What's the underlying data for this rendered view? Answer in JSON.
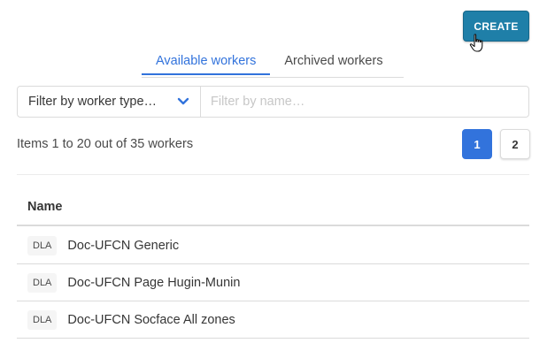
{
  "toolbar": {
    "create_label": "CREATE"
  },
  "tabs": [
    {
      "label": "Available workers",
      "active": true
    },
    {
      "label": "Archived workers",
      "active": false
    }
  ],
  "filters": {
    "type_select_value": "Filter by worker type…",
    "name_placeholder": "Filter by name…",
    "name_value": ""
  },
  "pagination": {
    "summary": "Items 1 to 20 out of 35 workers",
    "pages": [
      "1",
      "2"
    ],
    "current_page": "1"
  },
  "table": {
    "headers": [
      "Name"
    ],
    "rows": [
      {
        "type": "DLA",
        "name": "Doc-UFCN Generic"
      },
      {
        "type": "DLA",
        "name": "Doc-UFCN Page Hugin-Munin"
      },
      {
        "type": "DLA",
        "name": "Doc-UFCN Socface All zones"
      }
    ]
  },
  "colors": {
    "accent": "#3273dc",
    "create_button": "#1f7fa8"
  },
  "icons": [
    "chevron-down-icon",
    "hand-pointer-icon"
  ]
}
